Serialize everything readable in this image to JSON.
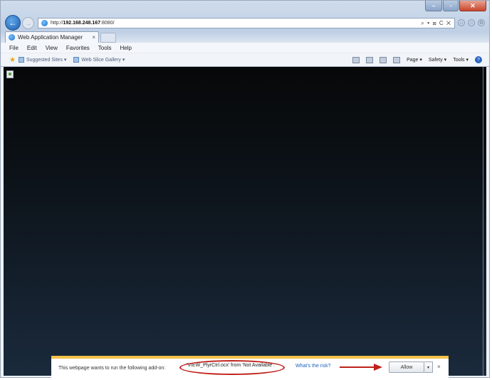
{
  "browser": {
    "url_prefix": "http://",
    "url_host": "192.168.248.167",
    "url_suffix": ":8080/",
    "address_tools": "⌕ ▾ ⊠ C ✕",
    "back_glyph": "←",
    "fwd_glyph": "→"
  },
  "tab": {
    "title": "Web Application Manager",
    "close": "×"
  },
  "menu": [
    "File",
    "Edit",
    "View",
    "Favorites",
    "Tools",
    "Help"
  ],
  "favorites": {
    "items": [
      "Suggested Sites ▾",
      "Web Slice Gallery ▾"
    ]
  },
  "command_bar": {
    "page": "Page ▾",
    "safety": "Safety ▾",
    "tools": "Tools ▾",
    "help": "?"
  },
  "notification": {
    "message": "This webpage wants to run the following add-on:",
    "addon": "'VIEW_PlyrCtrl.ocx' from 'Not Available'.",
    "whats_the_risk": "What's the risk?",
    "allow": "Allow",
    "dropdown": "▾",
    "close": "×"
  },
  "colors": {
    "annotation_red": "#c0211b",
    "notification_accent": "#f5c24a"
  }
}
